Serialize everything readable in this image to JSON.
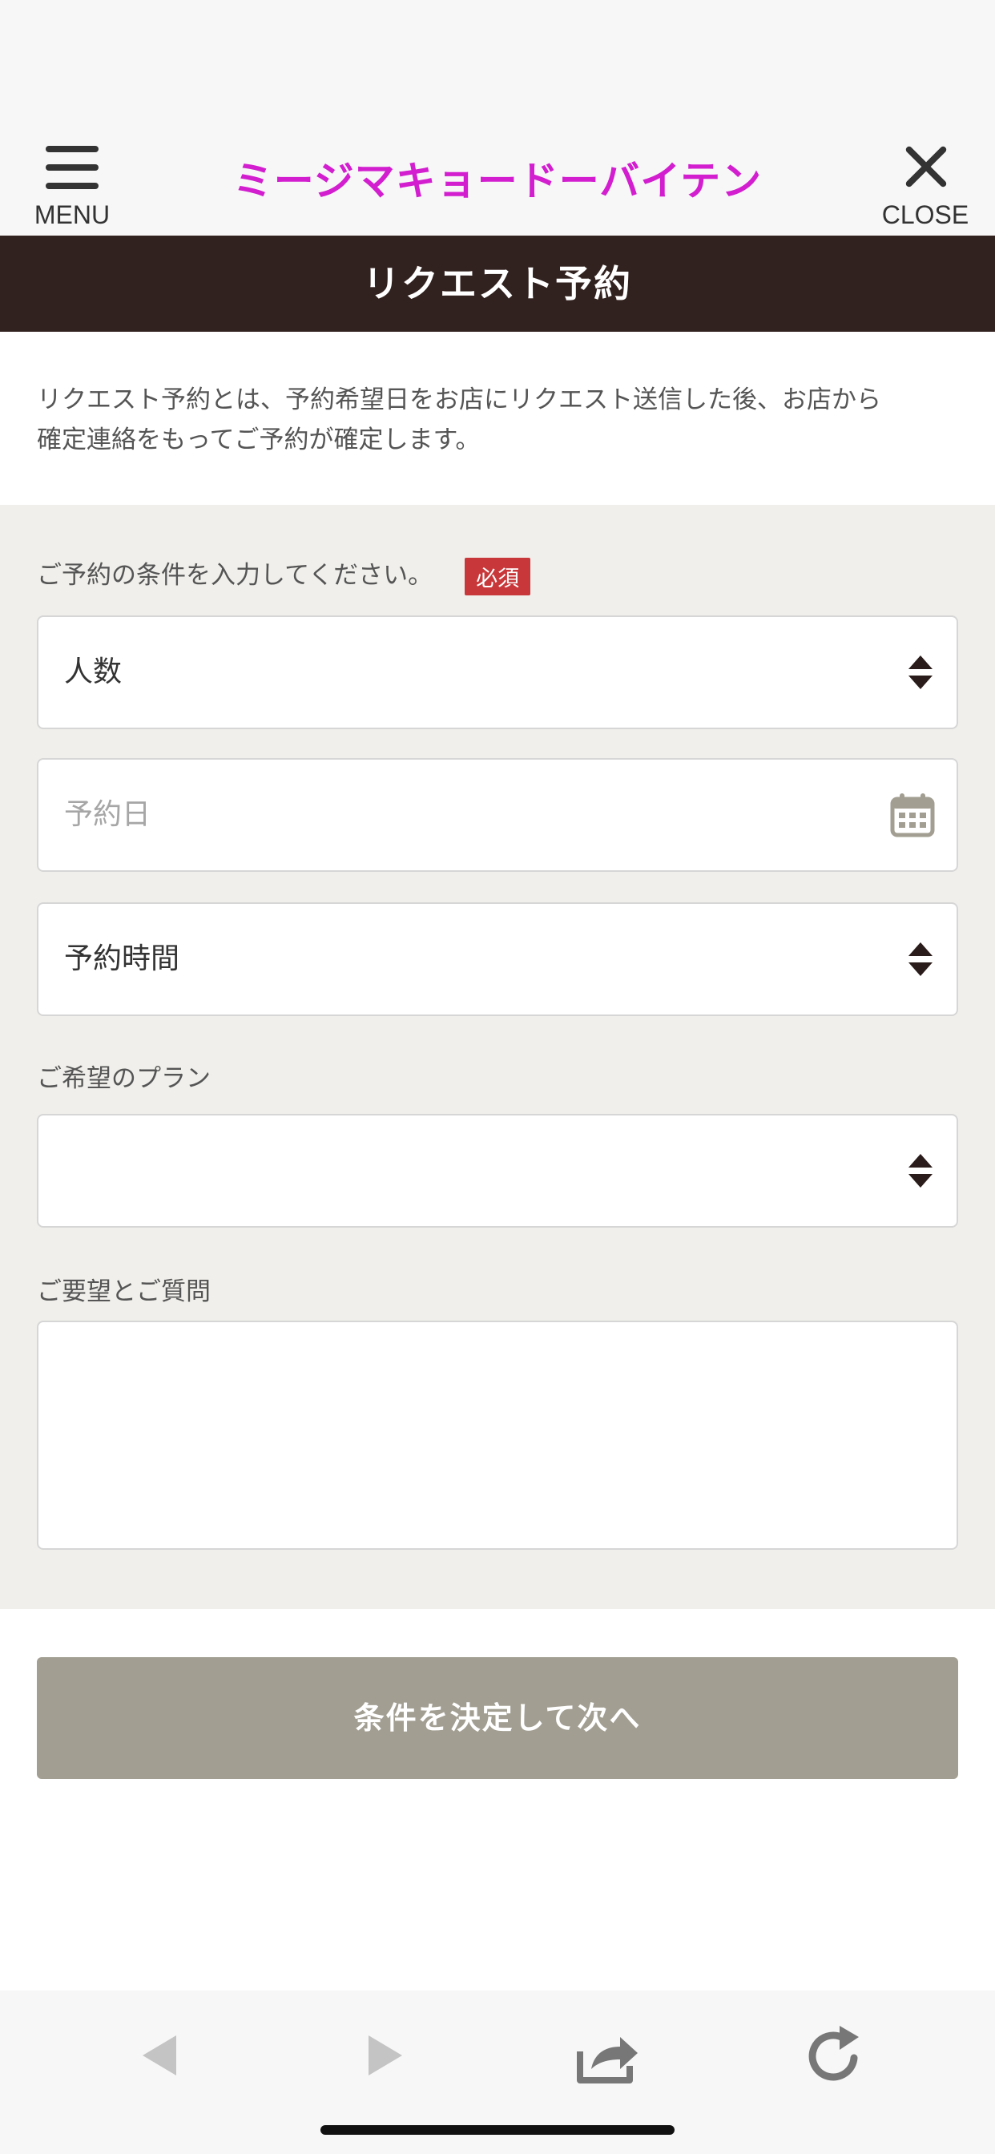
{
  "header": {
    "menu_label": "MENU",
    "site_title": "ミージマキョードーバイテン",
    "close_label": "CLOSE"
  },
  "title_bar": {
    "title": "リクエスト予約"
  },
  "intro": {
    "line1": "リクエスト予約とは、予約希望日をお店にリクエスト送信した後、お店から",
    "line2": "確定連絡をもってご予約が確定します。"
  },
  "form": {
    "conditions_label": "ご予約の条件を入力してください。",
    "required_badge": "必須",
    "party_size": {
      "value": "人数"
    },
    "date": {
      "placeholder": "予約日"
    },
    "time": {
      "value": "予約時間"
    },
    "plan_label": "ご希望のプラン",
    "plan": {
      "value": ""
    },
    "requests_label": "ご要望とご質問",
    "requests": {
      "value": ""
    }
  },
  "submit": {
    "label": "条件を決定して次へ"
  },
  "colors": {
    "title_pink": "#d21ecf",
    "title_bar": "#32221f",
    "form_bg": "#f0efeb",
    "badge_red": "#c8383a",
    "submit_bg": "#a29e92"
  },
  "toolbar": {
    "icons": [
      "back-arrow-icon",
      "forward-arrow-icon",
      "share-icon",
      "reload-icon"
    ]
  }
}
